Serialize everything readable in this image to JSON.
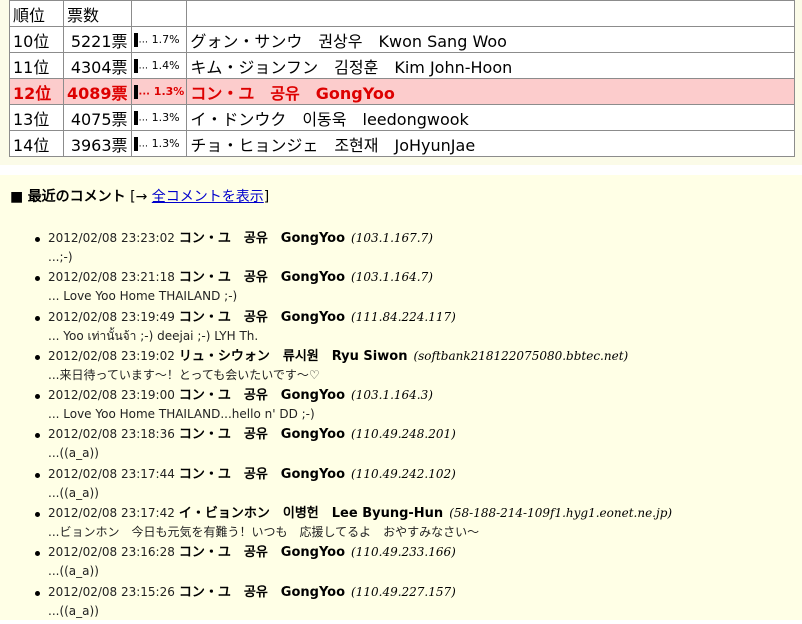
{
  "ranking": {
    "headers": {
      "rank": "順位",
      "votes": "票数"
    },
    "rows": [
      {
        "rank": "10位",
        "votes": "5221票",
        "pct": "1.7%",
        "bar_dots": "...",
        "name_jp": "グォン・サンウ",
        "name_kr": "권상우",
        "name_en": "Kwon Sang Woo",
        "highlight": false
      },
      {
        "rank": "11位",
        "votes": "4304票",
        "pct": "1.4%",
        "bar_dots": "...",
        "name_jp": "キム・ジョンフン",
        "name_kr": "김정훈",
        "name_en": "Kim John-Hoon",
        "highlight": false
      },
      {
        "rank": "12位",
        "votes": "4089票",
        "pct": "1.3%",
        "bar_dots": "...",
        "name_jp": "コン・ユ",
        "name_kr": "공유",
        "name_en": "GongYoo",
        "highlight": true
      },
      {
        "rank": "13位",
        "votes": "4075票",
        "pct": "1.3%",
        "bar_dots": "...",
        "name_jp": "イ・ドンウク",
        "name_kr": "이동욱",
        "name_en": "leedongwook",
        "highlight": false
      },
      {
        "rank": "14位",
        "votes": "3963票",
        "pct": "1.3%",
        "bar_dots": "...",
        "name_jp": "チョ・ヒョンジェ",
        "name_kr": "조현재",
        "name_en": "JoHyunJae",
        "highlight": false
      }
    ]
  },
  "comments_section": {
    "square": "■",
    "title": "最近のコメント",
    "bracket_open": "[→ ",
    "link_label": "全コメントを表示",
    "bracket_close": "]"
  },
  "comments": [
    {
      "time": "2012/02/08 23:23:02",
      "name": "コン・ユ　공유　GongYoo",
      "ip": "(103.1.167.7)",
      "text": "...;-)"
    },
    {
      "time": "2012/02/08 23:21:18",
      "name": "コン・ユ　공유　GongYoo",
      "ip": "(103.1.164.7)",
      "text": "... Love Yoo Home THAILAND ;-)"
    },
    {
      "time": "2012/02/08 23:19:49",
      "name": "コン・ユ　공유　GongYoo",
      "ip": "(111.84.224.117)",
      "text": "... Yoo เท่านั้นจ้า ;-) deejai ;-) LYH Th."
    },
    {
      "time": "2012/02/08 23:19:02",
      "name": "リュ・シウォン　류시원　Ryu Siwon",
      "ip": "(softbank218122075080.bbtec.net)",
      "text": "...来日待っています～！とっても会いたいです～♡"
    },
    {
      "time": "2012/02/08 23:19:00",
      "name": "コン・ユ　공유　GongYoo",
      "ip": "(103.1.164.3)",
      "text": "... Love Yoo Home THAILAND...hello n' DD ;-)"
    },
    {
      "time": "2012/02/08 23:18:36",
      "name": "コン・ユ　공유　GongYoo",
      "ip": "(110.49.248.201)",
      "text": "...((a_a))"
    },
    {
      "time": "2012/02/08 23:17:44",
      "name": "コン・ユ　공유　GongYoo",
      "ip": "(110.49.242.102)",
      "text": "...((a_a))"
    },
    {
      "time": "2012/02/08 23:17:42",
      "name": "イ・ビョンホン　이병헌　Lee Byung-Hun",
      "ip": "(58-188-214-109f1.hyg1.eonet.ne.jp)",
      "text": "...ビョンホン　今日も元気を有難う！いつも　応援してるよ　おやすみなさい～"
    },
    {
      "time": "2012/02/08 23:16:28",
      "name": "コン・ユ　공유　GongYoo",
      "ip": "(110.49.233.166)",
      "text": "...((a_a))"
    },
    {
      "time": "2012/02/08 23:15:26",
      "name": "コン・ユ　공유　GongYoo",
      "ip": "(110.49.227.157)",
      "text": "...((a_a))"
    }
  ]
}
